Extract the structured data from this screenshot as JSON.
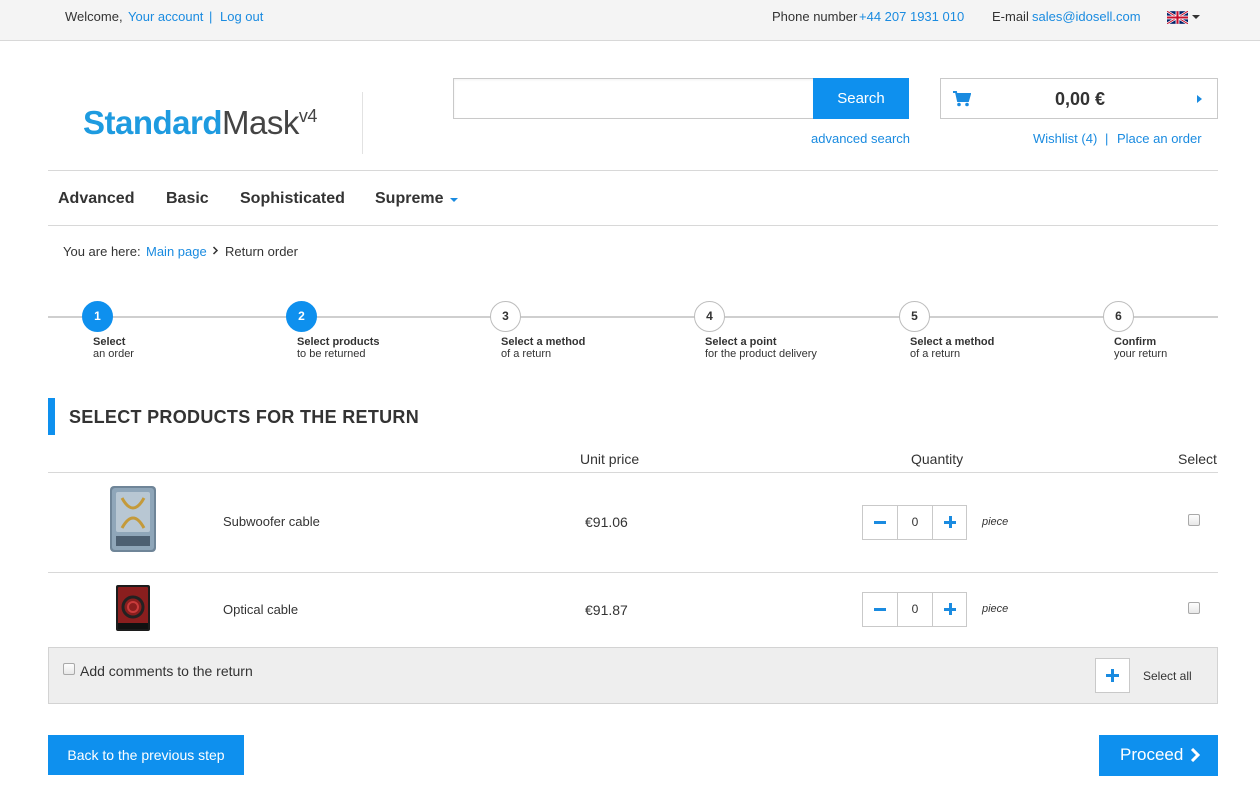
{
  "topbar": {
    "welcome": "Welcome,",
    "your_account": "Your account",
    "separator": "|",
    "log_out": "Log out",
    "phone_label": "Phone number",
    "phone_value": "+44 207 1931 010",
    "email_label": "E-mail",
    "email_value": "sales@idosell.com",
    "language_icon": "uk-flag-icon"
  },
  "header": {
    "logo_primary": "Standard",
    "logo_secondary": "Mask",
    "logo_version": "v4",
    "search_button": "Search",
    "search_placeholder": "",
    "advanced_search": "advanced search",
    "cart_total": "0,00 €",
    "wishlist": "Wishlist (4)",
    "place_order": "Place an order"
  },
  "menu": {
    "items": [
      "Advanced",
      "Basic",
      "Sophisticated",
      "Supreme"
    ]
  },
  "breadcrumb": {
    "prefix": "You are here:",
    "home": "Main page",
    "current": "Return order"
  },
  "steps": [
    {
      "num": "1",
      "title": "Select",
      "sub": "an order",
      "state": "active"
    },
    {
      "num": "2",
      "title": "Select products",
      "sub": "to be returned",
      "state": "active"
    },
    {
      "num": "3",
      "title": "Select a method",
      "sub": "of a return",
      "state": "inactive"
    },
    {
      "num": "4",
      "title": "Select a point",
      "sub": "for the product delivery",
      "state": "inactive"
    },
    {
      "num": "5",
      "title": "Select a method",
      "sub": "of a return",
      "state": "inactive"
    },
    {
      "num": "6",
      "title": "Confirm",
      "sub": "your return",
      "state": "inactive"
    }
  ],
  "section": {
    "title": "SELECT PRODUCTS FOR THE RETURN"
  },
  "table": {
    "headers": {
      "unit_price": "Unit price",
      "quantity": "Quantity",
      "select": "Select"
    },
    "rows": [
      {
        "name": "Subwoofer cable",
        "price": "€91.06",
        "qty": "0",
        "unit": "piece",
        "selected": false
      },
      {
        "name": "Optical cable",
        "price": "€91.87",
        "qty": "0",
        "unit": "piece",
        "selected": false
      }
    ]
  },
  "comments": {
    "label": "Add comments to the return",
    "select_all": "Select all"
  },
  "actions": {
    "back": "Back to the previous step",
    "proceed": "Proceed"
  },
  "colors": {
    "accent": "#0e90ee",
    "link": "#1a8be0",
    "logo": "#1e9be0"
  }
}
